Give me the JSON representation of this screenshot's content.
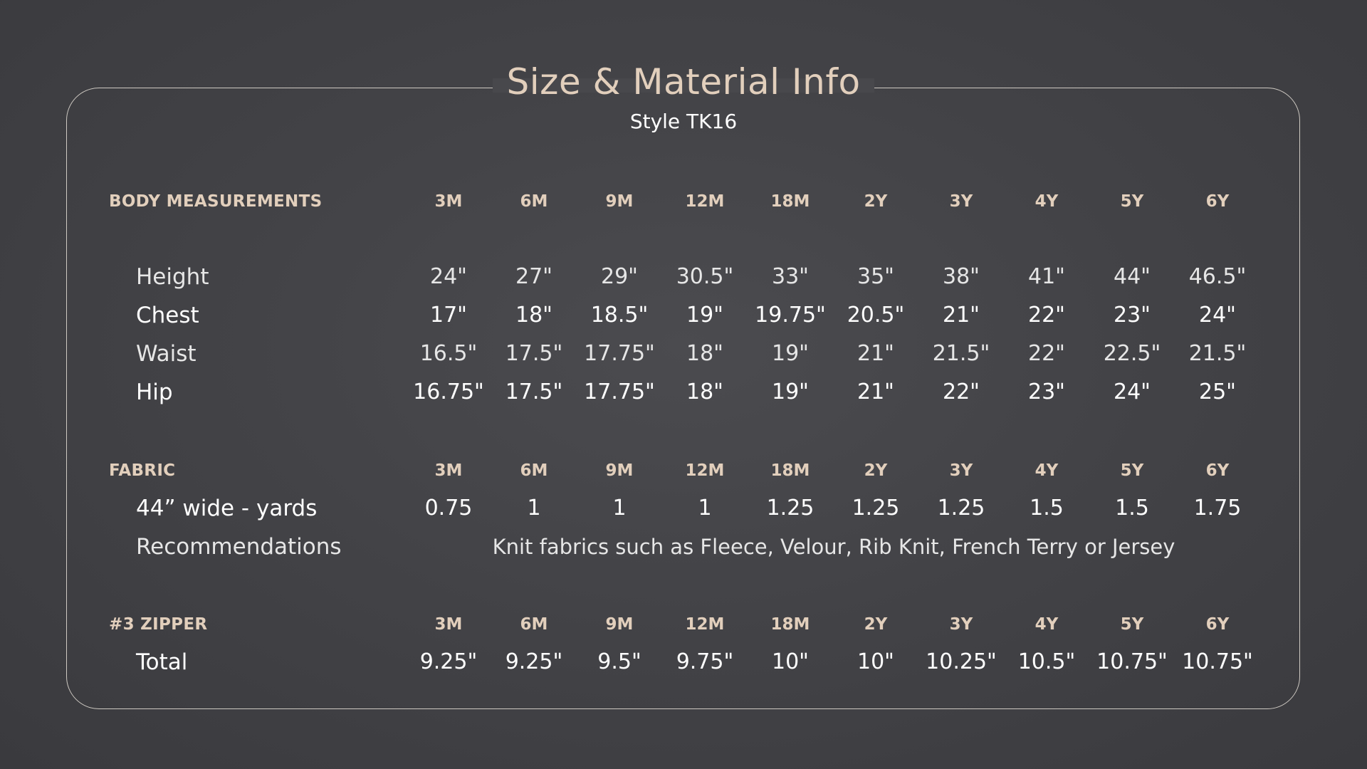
{
  "title": "Size & Material Info",
  "subtitle": "Style TK16",
  "sizes": [
    "3M",
    "6M",
    "9M",
    "12M",
    "18M",
    "2Y",
    "3Y",
    "4Y",
    "5Y",
    "6Y"
  ],
  "body": {
    "header": "BODY MEASUREMENTS",
    "rows": [
      {
        "label": "Height",
        "values": [
          "24\"",
          "27\"",
          "29\"",
          "30.5\"",
          "33\"",
          "35\"",
          "38\"",
          "41\"",
          "44\"",
          "46.5\""
        ]
      },
      {
        "label": "Chest",
        "values": [
          "17\"",
          "18\"",
          "18.5\"",
          "19\"",
          "19.75\"",
          "20.5\"",
          "21\"",
          "22\"",
          "23\"",
          "24\""
        ]
      },
      {
        "label": "Waist",
        "values": [
          "16.5\"",
          "17.5\"",
          "17.75\"",
          "18\"",
          "19\"",
          "21\"",
          "21.5\"",
          "22\"",
          "22.5\"",
          "21.5\""
        ]
      },
      {
        "label": "Hip",
        "values": [
          "16.75\"",
          "17.5\"",
          "17.75\"",
          "18\"",
          "19\"",
          "21\"",
          "22\"",
          "23\"",
          "24\"",
          "25\""
        ]
      }
    ]
  },
  "fabric": {
    "header": "FABRIC",
    "yards_label": "44” wide - yards",
    "yards": [
      "0.75",
      "1",
      "1",
      "1",
      "1.25",
      "1.25",
      "1.25",
      "1.5",
      "1.5",
      "1.75"
    ],
    "recommendations_label": "Recommendations",
    "recommendations": "Knit fabrics such as Fleece, Velour, Rib Knit, French Terry or Jersey"
  },
  "zipper": {
    "header": "#3 ZIPPER",
    "total_label": "Total",
    "totals": [
      "9.25\"",
      "9.25\"",
      "9.5\"",
      "9.75\"",
      "10\"",
      "10\"",
      "10.25\"",
      "10.5\"",
      "10.75\"",
      "10.75\""
    ]
  }
}
